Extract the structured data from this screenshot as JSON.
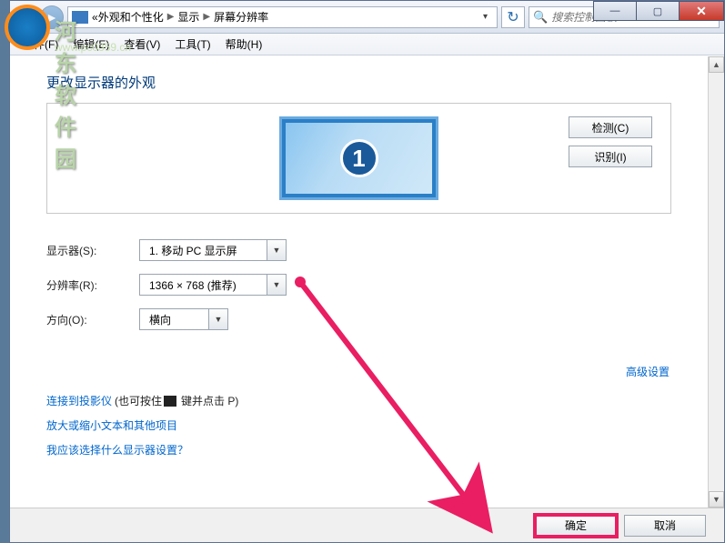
{
  "watermark": {
    "text": "河东软件园",
    "url": "www.pc0359.cn"
  },
  "titlebar": {
    "min": "—",
    "max": "▢",
    "close": "✕"
  },
  "breadcrumb": {
    "prefix": "«",
    "parts": [
      "外观和个性化",
      "显示",
      "屏幕分辨率"
    ]
  },
  "search": {
    "placeholder": "搜索控制面板"
  },
  "menubar": [
    "文件(F)",
    "编辑(E)",
    "查看(V)",
    "工具(T)",
    "帮助(H)"
  ],
  "heading": "更改显示器的外观",
  "monitor_number": "1",
  "side_buttons": {
    "detect": "检测(C)",
    "identify": "识别(I)"
  },
  "settings": {
    "display": {
      "label": "显示器(S):",
      "value": "1. 移动 PC 显示屏"
    },
    "resolution": {
      "label": "分辨率(R):",
      "value": "1366 × 768 (推荐)"
    },
    "orientation": {
      "label": "方向(O):",
      "value": "横向"
    }
  },
  "advanced_link": "高级设置",
  "links": {
    "projector": {
      "text": "连接到投影仪",
      "suffix_before": " (也可按住 ",
      "suffix_after": " 键并点击 P)"
    },
    "scale": "放大或缩小文本和其他项目",
    "which": "我应该选择什么显示器设置？"
  },
  "footer": {
    "ok": "确定",
    "cancel": "取消"
  }
}
